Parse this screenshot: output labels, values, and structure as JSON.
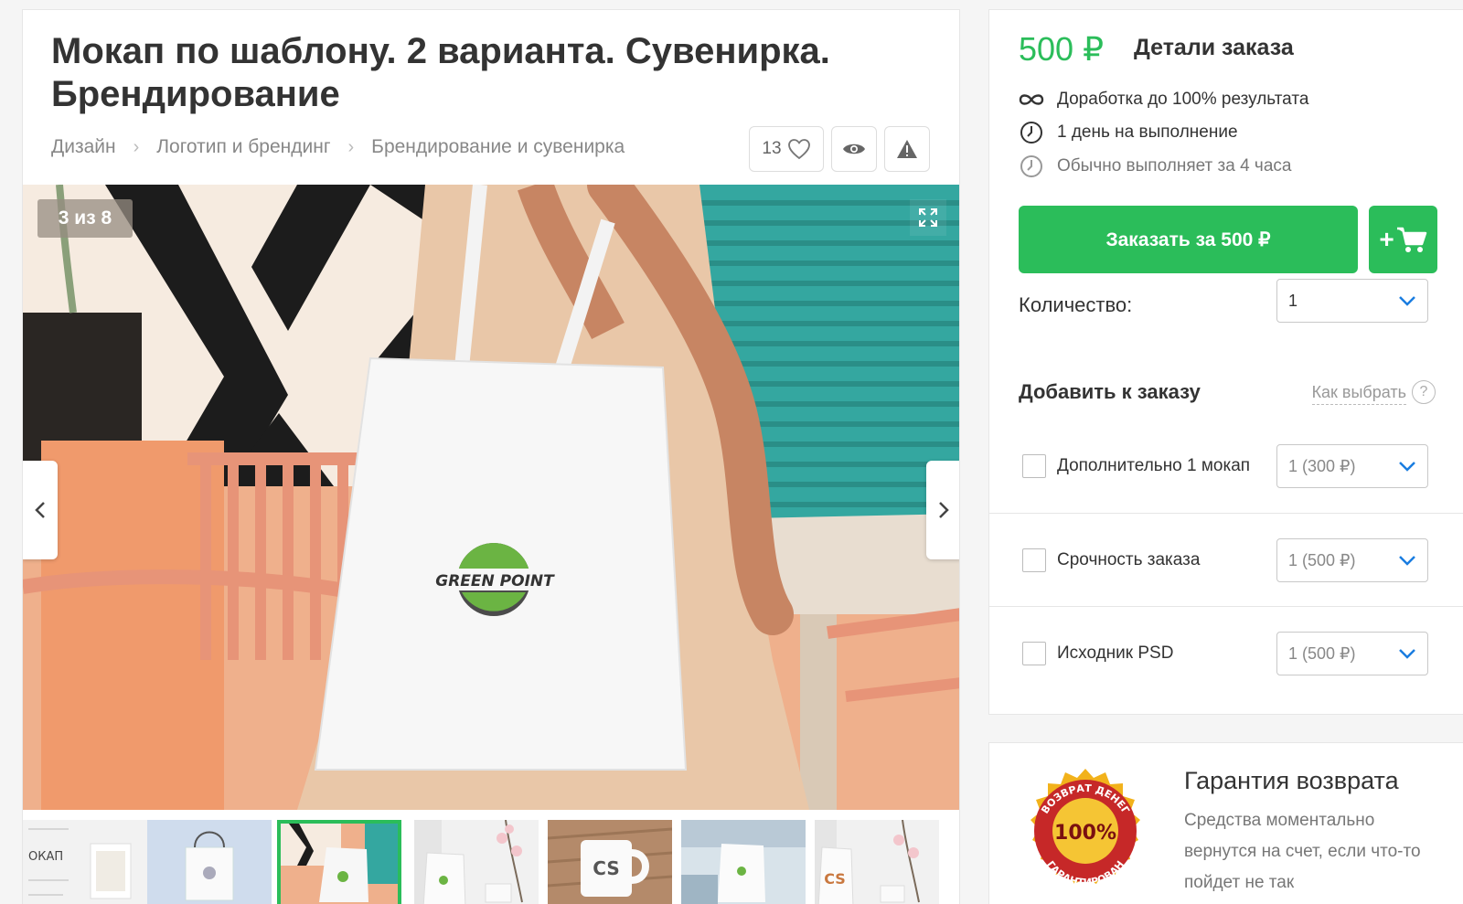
{
  "listing": {
    "title": "Мокап по шаблону. 2 варианта. Сувенирка. Брендирование",
    "breadcrumbs": [
      "Дизайн",
      "Логотип и брендинг",
      "Брендирование и сувенирка"
    ],
    "likes_count": "13"
  },
  "gallery": {
    "counter": "3 из 8",
    "bag_logo_text": "GREEN POINT",
    "thumbnails": [
      {
        "label": "Мокап шаблон",
        "text": "ОКАП"
      },
      {
        "label": "Пакет"
      },
      {
        "label": "Сумка (активно)"
      },
      {
        "label": "Сумка и цветы"
      },
      {
        "label": "Кружка",
        "text": "CS"
      },
      {
        "label": "Сумка на столе"
      },
      {
        "label": "Сувенирка",
        "text": "CS"
      }
    ],
    "active_index": 2
  },
  "order": {
    "price": "500 ₽",
    "details_title": "Детали заказа",
    "features": [
      {
        "icon": "infinity-icon",
        "text": "Доработка до 100% результата"
      },
      {
        "icon": "clock-icon",
        "text": "1 день на выполнение"
      },
      {
        "icon": "clock-icon",
        "text": "Обычно выполняет за 4 часа"
      }
    ],
    "order_button": "Заказать за 500 ₽",
    "cart_plus": "+",
    "quantity_label": "Количество:",
    "quantity_value": "1",
    "addons_title": "Добавить к заказу",
    "how_choose": "Как выбрать",
    "help": "?",
    "addons": [
      {
        "label": "Дополнительно 1 мокап",
        "select": "1 (300 ₽)"
      },
      {
        "label": "Срочность заказа",
        "select": "1 (500 ₽)"
      },
      {
        "label": "Исходник PSD",
        "select": "1 (500 ₽)"
      }
    ]
  },
  "guarantee": {
    "title": "Гарантия возврата",
    "text": "Средства моментально вернутся на счет, если что-то пойдет не так",
    "seal_top": "ВОЗВРАТ ДЕНЕГ",
    "seal_center": "100%",
    "seal_bottom": "ГАРАНТИРОВАН"
  },
  "colors": {
    "accent": "#2bbd5a",
    "select_chevron": "#1a7de0"
  }
}
